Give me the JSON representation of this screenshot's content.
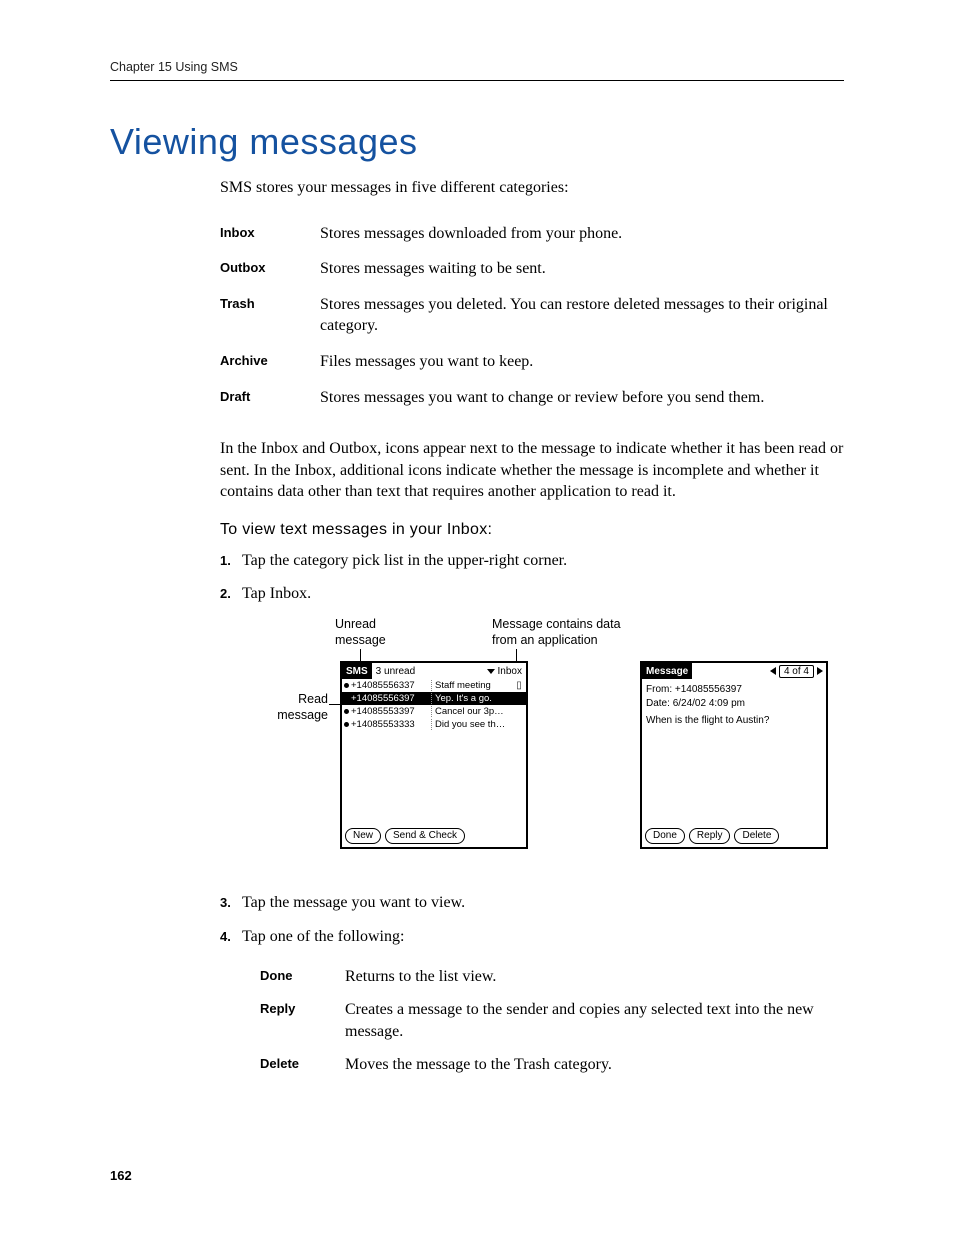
{
  "running_head": "Chapter 15    Using SMS",
  "section_title": "Viewing messages",
  "intro": "SMS stores your messages in five different categories:",
  "categories": [
    {
      "term": "Inbox",
      "desc": "Stores messages downloaded from your phone."
    },
    {
      "term": "Outbox",
      "desc": "Stores messages waiting to be sent."
    },
    {
      "term": "Trash",
      "desc": "Stores messages you deleted. You can restore deleted messages to their original category."
    },
    {
      "term": "Archive",
      "desc": "Files messages you want to keep."
    },
    {
      "term": "Draft",
      "desc": "Stores messages you want to change or review before you send them."
    }
  ],
  "para_after": "In the Inbox and Outbox, icons appear next to the message to indicate whether it has been read or sent. In the Inbox, additional icons indicate whether the message is incomplete and whether it contains data other than text that requires another application to read it.",
  "subhead": "To view text messages in your Inbox:",
  "steps_a": [
    "Tap the category pick list in the upper-right corner.",
    "Tap Inbox."
  ],
  "callouts": {
    "unread": "Unread\nmessage",
    "read": "Read\nmessage",
    "dataapp": "Message contains data\nfrom an application"
  },
  "palm_list": {
    "app": "SMS",
    "status": "3 unread",
    "picker": "Inbox",
    "rows": [
      {
        "unread": true,
        "num": "+14085556337",
        "subj": "Staff meeting",
        "data": true,
        "sel": false
      },
      {
        "unread": false,
        "num": "+14085556397",
        "subj": "Yep. It's a go.",
        "data": false,
        "sel": true
      },
      {
        "unread": true,
        "num": "+14085553397",
        "subj": "Cancel our 3p…",
        "data": false,
        "sel": false
      },
      {
        "unread": true,
        "num": "+14085553333",
        "subj": "Did you see th…",
        "data": false,
        "sel": false
      }
    ],
    "buttons": {
      "new": "New",
      "send_check": "Send & Check"
    }
  },
  "palm_msg": {
    "app": "Message",
    "navcount": "4 of 4",
    "from_label": "From:",
    "from_value": "+14085556397",
    "date_label": "Date:",
    "date_value": "6/24/02 4:09 pm",
    "body": "When is the flight to Austin?",
    "buttons": {
      "done": "Done",
      "reply": "Reply",
      "delete": "Delete"
    }
  },
  "steps_b": [
    "Tap the message you want to view.",
    "Tap one of the following:"
  ],
  "actions": [
    {
      "term": "Done",
      "desc": "Returns to the list view."
    },
    {
      "term": "Reply",
      "desc": "Creates a message to the sender and copies any selected text into the new message."
    },
    {
      "term": "Delete",
      "desc": "Moves the message to the Trash category."
    }
  ],
  "page_number": "162"
}
